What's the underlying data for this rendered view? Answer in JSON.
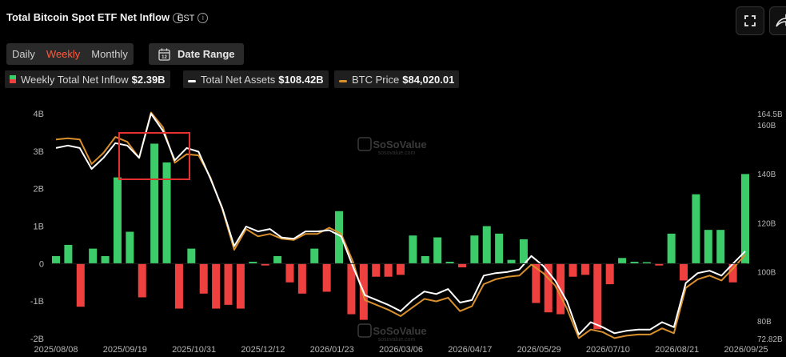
{
  "header": {
    "title": "Total Bitcoin Spot ETF Net Inflow",
    "timezone": "EST"
  },
  "controls": {
    "tabs": [
      {
        "label": "Daily",
        "active": false
      },
      {
        "label": "Weekly",
        "active": true
      },
      {
        "label": "Monthly",
        "active": false
      }
    ],
    "date_range_label": "Date Range"
  },
  "legend": {
    "items": [
      {
        "label": "Weekly Total Net Inflow",
        "value": "$2.39B"
      },
      {
        "label": "Total Net Assets",
        "value": "$108.42B"
      },
      {
        "label": "BTC Price",
        "value": "$84,020.01"
      }
    ]
  },
  "watermark": {
    "text": "SoSoValue",
    "sub": "sosovalue.com"
  },
  "icons": [
    "fullscreen-icon",
    "share-icon",
    "info-icon",
    "calendar-icon"
  ],
  "colors": {
    "inflow_positive": "#3dcc6a",
    "inflow_negative": "#ef4040",
    "net_assets_line": "#ffffff",
    "btc_price_line": "#d9902c",
    "accent": "#ff5a3c",
    "highlight_box": "#e53030"
  },
  "chart_data": {
    "type": "bar",
    "x_tick_labels": [
      "2025/08/08",
      "2025/09/19",
      "2025/10/31",
      "2025/12/12",
      "2026/01/23",
      "2026/03/06",
      "2026/04/17",
      "2026/05/29",
      "2026/07/10",
      "2026/08/21",
      "2026/09/25"
    ],
    "left_axis": {
      "ticks": [
        "4B",
        "3B",
        "2B",
        "1B",
        "0",
        "-1B",
        "-2B"
      ],
      "range": [
        -2,
        4
      ],
      "unit": "B"
    },
    "right_axis": {
      "ticks": [
        "164.5B",
        "160B",
        "140B",
        "120B",
        "100B",
        "80B",
        "72.82B"
      ],
      "range": [
        72.82,
        164.5
      ],
      "unit": "B"
    },
    "series": [
      {
        "name": "Weekly Total Net Inflow",
        "type": "bar",
        "axis": "left",
        "values": [
          0.2,
          0.5,
          -1.15,
          0.4,
          0.2,
          2.3,
          0.85,
          -0.9,
          3.2,
          2.7,
          -1.2,
          0.4,
          -0.8,
          -1.2,
          -1.1,
          -1.2,
          0.05,
          -0.05,
          0.2,
          -0.5,
          -0.8,
          0.4,
          -0.75,
          1.4,
          -1.35,
          -1.5,
          -0.35,
          -0.35,
          -0.3,
          0.75,
          0.2,
          0.7,
          0.05,
          -0.1,
          0.75,
          1.0,
          0.8,
          0.1,
          0.65,
          -1.05,
          -1.3,
          -1.35,
          -0.35,
          -0.3,
          -1.75,
          -0.55,
          0.15,
          0.05,
          0.04,
          -0.05,
          0.8,
          -0.45,
          1.85,
          0.9,
          0.9,
          -0.5,
          2.39
        ]
      },
      {
        "name": "Total Net Assets",
        "type": "line",
        "axis": "right",
        "values": [
          150.5,
          151.5,
          150.5,
          142,
          146.5,
          152.5,
          151.5,
          146.5,
          164.5,
          157.5,
          145.5,
          150.5,
          149,
          138,
          126,
          110.5,
          118.5,
          116.5,
          117.5,
          114,
          113.5,
          116.5,
          116.5,
          117,
          114.5,
          102,
          90.5,
          88.5,
          86.5,
          84,
          88.5,
          92,
          91,
          93,
          87.5,
          88.5,
          98.5,
          99.5,
          100,
          101,
          106.5,
          102.5,
          96.5,
          88,
          74.5,
          79.5,
          77.5,
          75,
          76,
          76.5,
          76.5,
          79.5,
          77.5,
          95.5,
          99.5,
          100.5,
          98.5,
          103.5,
          108.42
        ]
      },
      {
        "name": "BTC Price",
        "type": "line",
        "axis": "right",
        "values": [
          154,
          154.5,
          154,
          144,
          148.5,
          155,
          153,
          146.5,
          165,
          159,
          144.5,
          148,
          147.5,
          138.5,
          125.5,
          109,
          117.5,
          114.5,
          115.5,
          113.5,
          113,
          115.5,
          115.5,
          118,
          115.5,
          104,
          88.5,
          86.5,
          84.5,
          82,
          85.5,
          89,
          88,
          89.5,
          84,
          86,
          95,
          97,
          98,
          98.5,
          103,
          99.5,
          94.5,
          85,
          73,
          76.5,
          75.5,
          73,
          74,
          74.5,
          74.5,
          77,
          75,
          93.5,
          97,
          98.5,
          96.5,
          101.5,
          107
        ]
      }
    ]
  }
}
